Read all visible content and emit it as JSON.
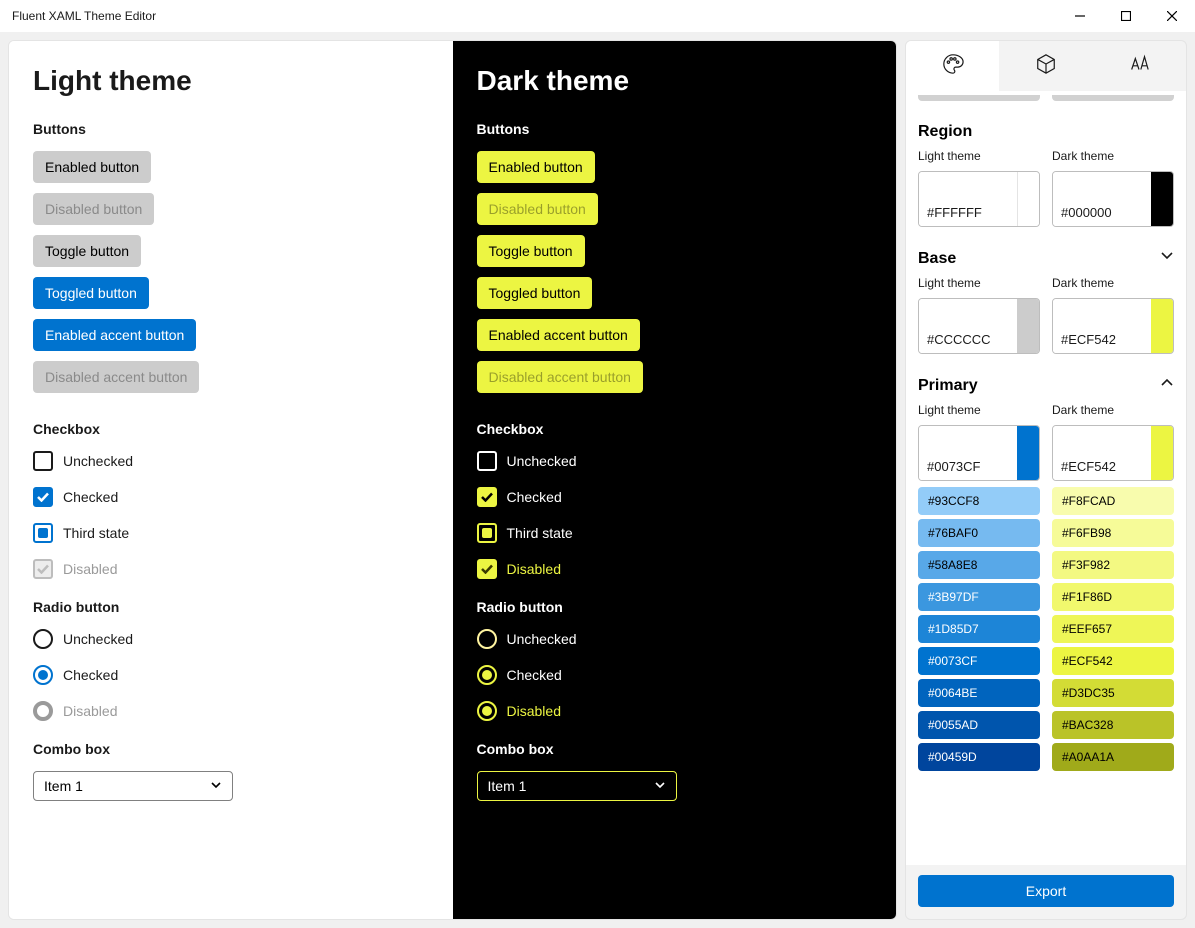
{
  "window": {
    "title": "Fluent XAML Theme Editor"
  },
  "light": {
    "title": "Light theme",
    "sections": {
      "buttons": "Buttons",
      "checkbox": "Checkbox",
      "radio": "Radio button",
      "combo": "Combo box"
    },
    "buttons": {
      "enabled": "Enabled button",
      "disabled": "Disabled button",
      "toggle": "Toggle button",
      "toggled": "Toggled button",
      "accent": "Enabled accent button",
      "accentdis": "Disabled accent button"
    },
    "checkbox": {
      "unchecked": "Unchecked",
      "checked": "Checked",
      "third": "Third state",
      "disabled": "Disabled"
    },
    "radio": {
      "unchecked": "Unchecked",
      "checked": "Checked",
      "disabled": "Disabled"
    },
    "combo": {
      "selected": "Item 1"
    }
  },
  "dark": {
    "title": "Dark theme",
    "sections": {
      "buttons": "Buttons",
      "checkbox": "Checkbox",
      "radio": "Radio button",
      "combo": "Combo box"
    },
    "buttons": {
      "enabled": "Enabled button",
      "disabled": "Disabled button",
      "toggle": "Toggle button",
      "toggled": "Toggled button",
      "accent": "Enabled accent button",
      "accentdis": "Disabled accent button"
    },
    "checkbox": {
      "unchecked": "Unchecked",
      "checked": "Checked",
      "third": "Third state",
      "disabled": "Disabled"
    },
    "radio": {
      "unchecked": "Unchecked",
      "checked": "Checked",
      "disabled": "Disabled"
    },
    "combo": {
      "selected": "Item 1"
    }
  },
  "side": {
    "region": {
      "title": "Region",
      "llabel": "Light theme",
      "dlabel": "Dark theme",
      "lval": "#FFFFFF",
      "dval": "#000000"
    },
    "base": {
      "title": "Base",
      "llabel": "Light theme",
      "dlabel": "Dark theme",
      "lval": "#CCCCCC",
      "dval": "#ECF542"
    },
    "primary": {
      "title": "Primary",
      "llabel": "Light theme",
      "dlabel": "Dark theme",
      "lval": "#0073CF",
      "dval": "#ECF542"
    },
    "lpal": [
      {
        "hex": "#93CCF8"
      },
      {
        "hex": "#76BAF0"
      },
      {
        "hex": "#58A8E8"
      },
      {
        "hex": "#3B97DF"
      },
      {
        "hex": "#1D85D7"
      },
      {
        "hex": "#0073CF"
      },
      {
        "hex": "#0064BE"
      },
      {
        "hex": "#0055AD"
      },
      {
        "hex": "#00459D"
      }
    ],
    "dpal": [
      {
        "hex": "#F8FCAD"
      },
      {
        "hex": "#F6FB98"
      },
      {
        "hex": "#F3F982"
      },
      {
        "hex": "#F1F86D"
      },
      {
        "hex": "#EEF657"
      },
      {
        "hex": "#ECF542"
      },
      {
        "hex": "#D3DC35"
      },
      {
        "hex": "#BAC328"
      },
      {
        "hex": "#A0AA1A"
      }
    ],
    "export": "Export"
  }
}
